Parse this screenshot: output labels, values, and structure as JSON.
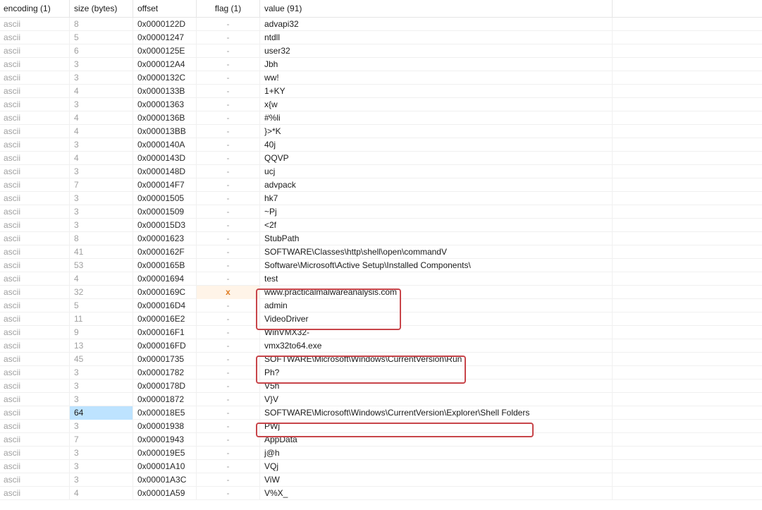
{
  "columns": [
    {
      "key": "encoding",
      "label": "encoding (1)"
    },
    {
      "key": "size",
      "label": "size (bytes)"
    },
    {
      "key": "offset",
      "label": "offset"
    },
    {
      "key": "flag",
      "label": "flag (1)"
    },
    {
      "key": "value",
      "label": "value (91)"
    }
  ],
  "rows": [
    {
      "encoding": "ascii",
      "size": "8",
      "offset": "0x0000122D",
      "flag": "-",
      "value": "advapi32"
    },
    {
      "encoding": "ascii",
      "size": "5",
      "offset": "0x00001247",
      "flag": "-",
      "value": "ntdll"
    },
    {
      "encoding": "ascii",
      "size": "6",
      "offset": "0x0000125E",
      "flag": "-",
      "value": "user32"
    },
    {
      "encoding": "ascii",
      "size": "3",
      "offset": "0x000012A4",
      "flag": "-",
      "value": "Jbh"
    },
    {
      "encoding": "ascii",
      "size": "3",
      "offset": "0x0000132C",
      "flag": "-",
      "value": "ww!"
    },
    {
      "encoding": "ascii",
      "size": "4",
      "offset": "0x0000133B",
      "flag": "-",
      "value": "1+KY"
    },
    {
      "encoding": "ascii",
      "size": "3",
      "offset": "0x00001363",
      "flag": "-",
      "value": "x{w"
    },
    {
      "encoding": "ascii",
      "size": "4",
      "offset": "0x0000136B",
      "flag": "-",
      "value": "#%li"
    },
    {
      "encoding": "ascii",
      "size": "4",
      "offset": "0x000013BB",
      "flag": "-",
      "value": "}>*K"
    },
    {
      "encoding": "ascii",
      "size": "3",
      "offset": "0x0000140A",
      "flag": "-",
      "value": "40j"
    },
    {
      "encoding": "ascii",
      "size": "4",
      "offset": "0x0000143D",
      "flag": "-",
      "value": "QQVP"
    },
    {
      "encoding": "ascii",
      "size": "3",
      "offset": "0x0000148D",
      "flag": "-",
      "value": "ucj"
    },
    {
      "encoding": "ascii",
      "size": "7",
      "offset": "0x000014F7",
      "flag": "-",
      "value": "advpack"
    },
    {
      "encoding": "ascii",
      "size": "3",
      "offset": "0x00001505",
      "flag": "-",
      "value": "hk7"
    },
    {
      "encoding": "ascii",
      "size": "3",
      "offset": "0x00001509",
      "flag": "-",
      "value": "~Pj"
    },
    {
      "encoding": "ascii",
      "size": "3",
      "offset": "0x000015D3",
      "flag": "-",
      "value": "<2f"
    },
    {
      "encoding": "ascii",
      "size": "8",
      "offset": "0x00001623",
      "flag": "-",
      "value": "StubPath"
    },
    {
      "encoding": "ascii",
      "size": "41",
      "offset": "0x0000162F",
      "flag": "-",
      "value": "SOFTWARE\\Classes\\http\\shell\\open\\commandV"
    },
    {
      "encoding": "ascii",
      "size": "53",
      "offset": "0x0000165B",
      "flag": "-",
      "value": "Software\\Microsoft\\Active Setup\\Installed Components\\"
    },
    {
      "encoding": "ascii",
      "size": "4",
      "offset": "0x00001694",
      "flag": "-",
      "value": "test"
    },
    {
      "encoding": "ascii",
      "size": "32",
      "offset": "0x0000169C",
      "flag": "x",
      "value": "www.practicalmalwareanalysis.com",
      "flagged": true
    },
    {
      "encoding": "ascii",
      "size": "5",
      "offset": "0x000016D4",
      "flag": "-",
      "value": "admin"
    },
    {
      "encoding": "ascii",
      "size": "11",
      "offset": "0x000016E2",
      "flag": "-",
      "value": "VideoDriver"
    },
    {
      "encoding": "ascii",
      "size": "9",
      "offset": "0x000016F1",
      "flag": "-",
      "value": "WinVMX32-"
    },
    {
      "encoding": "ascii",
      "size": "13",
      "offset": "0x000016FD",
      "flag": "-",
      "value": "vmx32to64.exe"
    },
    {
      "encoding": "ascii",
      "size": "45",
      "offset": "0x00001735",
      "flag": "-",
      "value": "SOFTWARE\\Microsoft\\Windows\\CurrentVersion\\Run"
    },
    {
      "encoding": "ascii",
      "size": "3",
      "offset": "0x00001782",
      "flag": "-",
      "value": "Ph?"
    },
    {
      "encoding": "ascii",
      "size": "3",
      "offset": "0x0000178D",
      "flag": "-",
      "value": "V5h"
    },
    {
      "encoding": "ascii",
      "size": "3",
      "offset": "0x00001872",
      "flag": "-",
      "value": "V}V"
    },
    {
      "encoding": "ascii",
      "size": "64",
      "offset": "0x000018E5",
      "flag": "-",
      "value": "SOFTWARE\\Microsoft\\Windows\\CurrentVersion\\Explorer\\Shell Folders",
      "selected": true
    },
    {
      "encoding": "ascii",
      "size": "3",
      "offset": "0x00001938",
      "flag": "-",
      "value": "PWj"
    },
    {
      "encoding": "ascii",
      "size": "7",
      "offset": "0x00001943",
      "flag": "-",
      "value": "AppData"
    },
    {
      "encoding": "ascii",
      "size": "3",
      "offset": "0x000019E5",
      "flag": "-",
      "value": "j@h"
    },
    {
      "encoding": "ascii",
      "size": "3",
      "offset": "0x00001A10",
      "flag": "-",
      "value": "VQj"
    },
    {
      "encoding": "ascii",
      "size": "3",
      "offset": "0x00001A3C",
      "flag": "-",
      "value": "ViW"
    },
    {
      "encoding": "ascii",
      "size": "4",
      "offset": "0x00001A59",
      "flag": "-",
      "value": "V%X_"
    }
  ],
  "annotation_boxes": [
    {
      "from_row": 19,
      "to_row": 21
    },
    {
      "from_row": 24,
      "to_row": 25
    },
    {
      "from_row": 29,
      "to_row": 29
    }
  ],
  "colors": {
    "annotation": "#c8454a",
    "selection": "#bde3ff",
    "flag_mark": "#e07a1f"
  }
}
